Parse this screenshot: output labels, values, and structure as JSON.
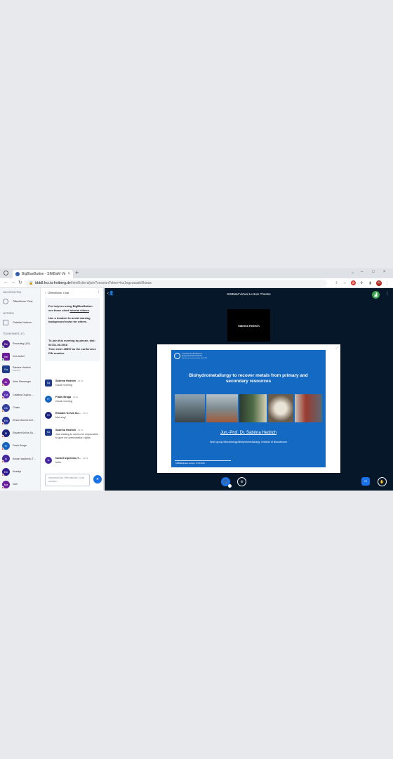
{
  "browser": {
    "tab_title": "BigBlueButton - SIMBaM Virtual",
    "new_tab": "+",
    "url_host": "bbb8.hrz.tu-freiberg.de",
    "url_path": "/html5client/join?sessionToken=ha1ngzusadn9kmax",
    "profile_initial": "H",
    "win_min": "–",
    "win_max": "□",
    "win_close": "×"
  },
  "sidebar": {
    "messages_header": "NACHRICHTEN",
    "public_chat_label": "Öffentlicher Chat",
    "notes_header": "NOTIZEN",
    "shared_notes_label": "Geteilte Notizen",
    "participants_header": "TEILNEHMER (17)",
    "users": [
      {
        "initials": "Re",
        "name": "Recording (US)",
        "sub": "",
        "color": "#4a1f8c",
        "dot": "grn",
        "shape": "round"
      },
      {
        "initials": "Ine",
        "name": "Ines Aubel",
        "sub": "",
        "color": "#6a1b9a",
        "dot": "grn",
        "shape": "sq"
      },
      {
        "initials": "Sa",
        "name": "Sabrina Hedrich",
        "sub": "(Sie/Du)",
        "color": "#1f3b8c",
        "dot": "",
        "shape": "sq"
      },
      {
        "initials": "Ar",
        "name": "Anke Bessenger",
        "sub": "",
        "color": "#7b1fa2",
        "dot": "red",
        "shape": "round"
      },
      {
        "initials": "Ca",
        "name": "Catalina Ospina-…",
        "sub": "",
        "color": "#5e35b1",
        "dot": "red",
        "shape": "round"
      },
      {
        "initials": "Ch",
        "name": "Chalis",
        "sub": "",
        "color": "#303f9f",
        "dot": "red",
        "shape": "round"
      },
      {
        "initials": "Eh",
        "name": "Ehsan Ahmed Arif…",
        "sub": "",
        "color": "#283593",
        "dot": "red",
        "shape": "round"
      },
      {
        "initials": "El",
        "name": "Elisabet Kelvia Su…",
        "sub": "",
        "color": "#1a237e",
        "dot": "red",
        "shape": "round"
      },
      {
        "initials": "Fr",
        "name": "Frank Braga",
        "sub": "",
        "color": "#1565c0",
        "dot": "red",
        "shape": "round"
      },
      {
        "initials": "Is",
        "name": "Ismael Izquierdo-T…",
        "sub": "",
        "color": "#4527a0",
        "dot": "red",
        "shape": "round"
      },
      {
        "initials": "Kh",
        "name": "Khadija",
        "sub": "",
        "color": "#311b92",
        "dot": "red",
        "shape": "round"
      },
      {
        "initials": "Ma",
        "name": "mah",
        "sub": "",
        "color": "#6a1b9a",
        "dot": "red",
        "shape": "round"
      }
    ]
  },
  "chat": {
    "header": "Öffentlicher Chat",
    "welcome": {
      "line1_a": "For help on using BigBlueButton see these short ",
      "line1_link": "tutorial videos",
      "line1_b": ".",
      "line2": "Use a headset to avoid causing background noise for others.",
      "line3": "To join this meeting by phone, dial:",
      "phone": "03731-39-4918",
      "line4": "Then enter 48557 as the conference PIN number."
    },
    "messages": [
      {
        "initials": "Sa",
        "name": "Sabrina Hedrich",
        "time": "09:22",
        "text": "Good morning",
        "color": "#1f3b8c",
        "shape": "sq"
      },
      {
        "initials": "Fr",
        "name": "Frank Braga",
        "time": "09:22",
        "text": "Good morning",
        "color": "#1565c0",
        "shape": "round"
      },
      {
        "initials": "El",
        "name": "Elisabet Kelvia Su...",
        "time": "09:22",
        "text": "Morning!",
        "color": "#1a237e",
        "shape": "round"
      },
      {
        "initials": "Sa",
        "name": "Sabrina Hedrich",
        "time": "09:22",
        "text": "Just waiting fo someone responsible to give me presentation rights",
        "color": "#1f3b8c",
        "shape": "sq"
      },
      {
        "initials": "Is",
        "name": "Ismael Izquierdo-T...",
        "time": "09:23",
        "text": "hello.",
        "color": "#4527a0",
        "shape": "round"
      }
    ],
    "input_placeholder": "Nachricht an Öffentlicher Chat senden"
  },
  "stage": {
    "title": "SIMBaM Virtual Lecture Theatre",
    "webcam_name": "Sabrina Hedrich",
    "slide": {
      "logo_text": "TECHNISCHE UNIVERSITÄT BERGAKADEMIE FREIBERG",
      "logo_sub": "Die Ressourcenuniversität. Seit 1765.",
      "title": "Biohydrometallurgy to recover metals from primary and secondary resources",
      "author": "Jun.-Prof. Dr. Sabrina Hedrich",
      "group": "Work group Microbiology/Biohydrometallurgy, Institute of Biosciences",
      "footer": "SIMBaM Expert Lecture, 17.06.2022"
    }
  },
  "colors": {
    "stage_bg": "#06172a",
    "slide_bg": "#1469c2",
    "accent": "#1a73e8",
    "connection": "#37a34a"
  }
}
